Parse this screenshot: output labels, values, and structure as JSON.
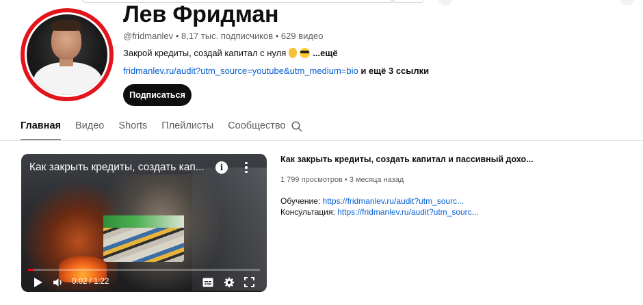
{
  "channel": {
    "name": "Лев Фридман",
    "handle": "@fridmanlev",
    "subscribers": "8,17 тыс. подписчиков",
    "video_count": "629 видео",
    "separator": " • ",
    "description": "Закрой кредиты, создай капитал с нуля",
    "description_more": "...ещё",
    "link_url": "fridmanlev.ru/audit?utm_source=youtube&utm_medium=bio",
    "link_more": " и ещё 3 ссылки",
    "subscribe_label": "Подписаться"
  },
  "tabs": [
    {
      "label": "Главная",
      "active": true
    },
    {
      "label": "Видео",
      "active": false
    },
    {
      "label": "Shorts",
      "active": false
    },
    {
      "label": "Плейлисты",
      "active": false
    },
    {
      "label": "Сообщество",
      "active": false
    }
  ],
  "featured": {
    "player_title": "Как закрыть кредиты, создать кап...",
    "time_current": "0:02",
    "time_total": "1:22",
    "time_sep": " / ",
    "progress": 0.025,
    "title": "Как закрыть кредиты, создать капитал и пассивный дохо...",
    "views": "1 799 просмотров",
    "age": "3 месяца назад",
    "sep": " • ",
    "desc_lines": [
      {
        "label": "Обучение: ",
        "url": "https://fridmanlev.ru/audit?utm_sourc..."
      },
      {
        "label": "Консультация: ",
        "url": "https://fridmanlev.ru/audit?utm_sourc..."
      }
    ]
  },
  "icons": {
    "hand": "backhand-index-pointing-down-icon",
    "cool": "smiling-face-with-sunglasses-icon",
    "search": "search-icon",
    "info": "info-icon",
    "more": "more-vert-icon",
    "play": "play-icon",
    "volume": "volume-icon",
    "subtitles": "subtitles-icon",
    "settings": "settings-icon",
    "fullscreen": "fullscreen-icon"
  },
  "colors": {
    "accent_link": "#065fd4",
    "avatar_ring": "#e4141c",
    "progress": "#ff0000"
  }
}
